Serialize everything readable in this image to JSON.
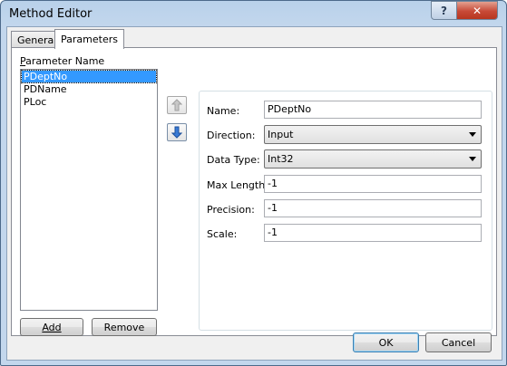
{
  "window": {
    "title": "Method Editor",
    "help_glyph": "?",
    "close_glyph": "✕"
  },
  "tabs": [
    {
      "label": "General"
    },
    {
      "label": "Parameters"
    }
  ],
  "parameters_panel": {
    "list_header": "Parameter Name",
    "items": [
      "PDeptNo",
      "PDName",
      "PLoc"
    ],
    "selected": "PDeptNo",
    "add_label": "Add",
    "remove_label": "Remove",
    "move_up_glyph": "⇧",
    "move_down_glyph": "⇩"
  },
  "properties": {
    "name_label": "Name:",
    "name_value": "PDeptNo",
    "direction_label": "Direction:",
    "direction_value": "Input",
    "datatype_label": "Data Type:",
    "datatype_value": "Int32",
    "maxlength_label": "Max Length:",
    "maxlength_value": "-1",
    "precision_label": "Precision:",
    "precision_value": "-1",
    "scale_label": "Scale:",
    "scale_value": "-1"
  },
  "footer": {
    "ok_label": "OK",
    "cancel_label": "Cancel"
  },
  "colors": {
    "selection": "#3399ff",
    "title_bar": "#b9d1ea",
    "close_button": "#c74a37"
  },
  "icons": {
    "help": "help-icon",
    "close": "close-icon",
    "up": "arrow-up-icon",
    "down": "arrow-down-icon"
  }
}
